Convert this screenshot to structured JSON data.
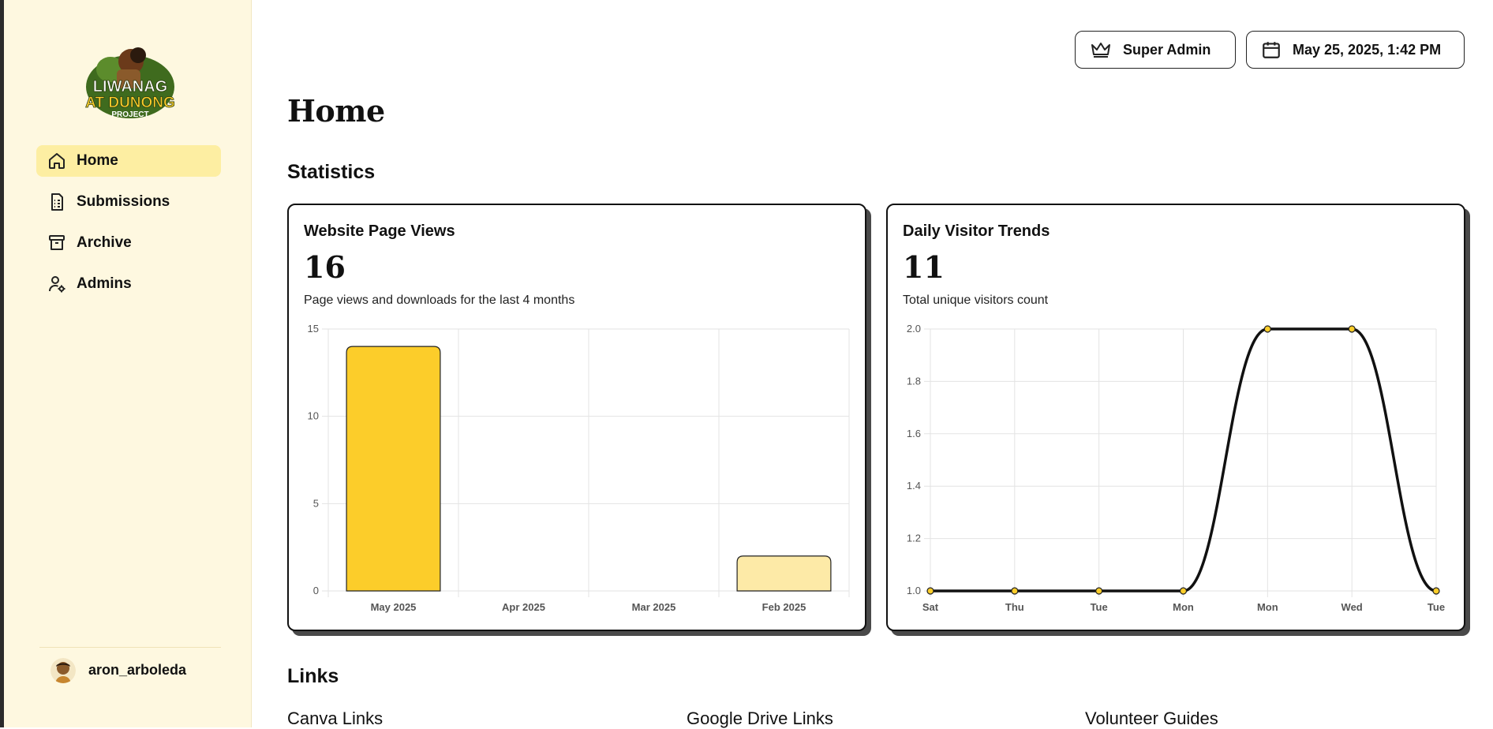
{
  "brand": {
    "logo_line1": "LIWANAG",
    "logo_line2": "AT DUNONG",
    "logo_line3": "PROJECT"
  },
  "sidebar": {
    "items": [
      {
        "label": "Home",
        "icon": "home-icon",
        "active": true
      },
      {
        "label": "Submissions",
        "icon": "document-list-icon",
        "active": false
      },
      {
        "label": "Archive",
        "icon": "archive-box-icon",
        "active": false
      },
      {
        "label": "Admins",
        "icon": "user-gear-icon",
        "active": false
      }
    ],
    "user": {
      "name": "aron_arboleda",
      "icon": "avatar"
    }
  },
  "header": {
    "role_label": "Super Admin",
    "role_icon": "crown-icon",
    "datetime": "May 25, 2025, 1:42 PM",
    "datetime_icon": "calendar-icon"
  },
  "page": {
    "title": "Home",
    "statistics_heading": "Statistics",
    "links_heading": "Links"
  },
  "cards": {
    "page_views": {
      "title": "Website Page Views",
      "value": "16",
      "description": "Page views and downloads for the last 4 months"
    },
    "visitors": {
      "title": "Daily Visitor Trends",
      "value": "11",
      "description": "Total unique visitors count"
    }
  },
  "links": {
    "columns": [
      "Canva Links",
      "Google Drive Links",
      "Volunteer Guides"
    ]
  },
  "colors": {
    "accent": "#fccd2a",
    "accent_light": "#fdeaa7",
    "sidebar_bg": "#fef8e0",
    "active_nav": "#fdeea2"
  },
  "chart_data": [
    {
      "type": "bar",
      "categories": [
        "May 2025",
        "Apr 2025",
        "Mar 2025",
        "Feb 2025"
      ],
      "values": [
        14,
        0,
        0,
        2
      ],
      "ylim": [
        0,
        15
      ],
      "yticks": [
        "0",
        "5",
        "10",
        "15"
      ],
      "bar_colors": [
        "#fccd2a",
        "#fdeaa7",
        "#fdeaa7",
        "#fdeaa7"
      ],
      "grid": true
    },
    {
      "type": "line",
      "x": [
        "Sat",
        "Thu",
        "Tue",
        "Mon",
        "Mon",
        "Wed",
        "Tue"
      ],
      "values": [
        1,
        1,
        1,
        1,
        2,
        2,
        1
      ],
      "ylim": [
        1.0,
        2.0
      ],
      "yticks": [
        "1.0",
        "1.2",
        "1.4",
        "1.6",
        "1.8",
        "2.0"
      ],
      "line_color": "#111111",
      "point_color": "#fccd2a",
      "grid": true
    }
  ]
}
